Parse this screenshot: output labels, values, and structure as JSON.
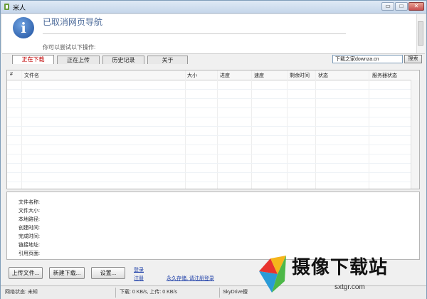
{
  "window": {
    "title": "米人"
  },
  "controls": {
    "minimize": "▭",
    "maximize": "□",
    "close": "✕"
  },
  "error": {
    "icon_glyph": "i",
    "title": "已取消网页导航",
    "subtitle": "你可以尝试以下操作:"
  },
  "tabs": [
    {
      "label": "正在下载",
      "active": true
    },
    {
      "label": "正在上传",
      "active": false
    },
    {
      "label": "历史记录",
      "active": false
    },
    {
      "label": "关于",
      "active": false
    }
  ],
  "search": {
    "value": "下载之家downza.cn",
    "button": "搜索"
  },
  "list": {
    "columns": [
      "#",
      "文件名",
      "大小",
      "进度",
      "速度",
      "剩余时间",
      "状态",
      "服务器状态"
    ],
    "rows": []
  },
  "details": {
    "labels": [
      "文件名称:",
      "文件大小:",
      "本地路径:",
      "创建时间:",
      "完成时间:",
      "链接地址:",
      "引用页面:"
    ]
  },
  "actions": {
    "upload": "上传文件...",
    "new_download": "新建下载...",
    "settings": "设置..."
  },
  "links": {
    "login": "登录",
    "register": "注册",
    "permanent": "永久存储, 请注册登录"
  },
  "status": {
    "network": "网络状态: 未知",
    "speed": "下载: 0 KB/s, 上传: 0 KB/s",
    "skydrive": "SkyDrive擅"
  },
  "watermark": {
    "text": "摄像下载站",
    "url": "sxtgr.com"
  },
  "colors": {
    "active_tab": "#c00000",
    "link": "#1e3fa8",
    "info_icon": "#1d4f9e"
  }
}
